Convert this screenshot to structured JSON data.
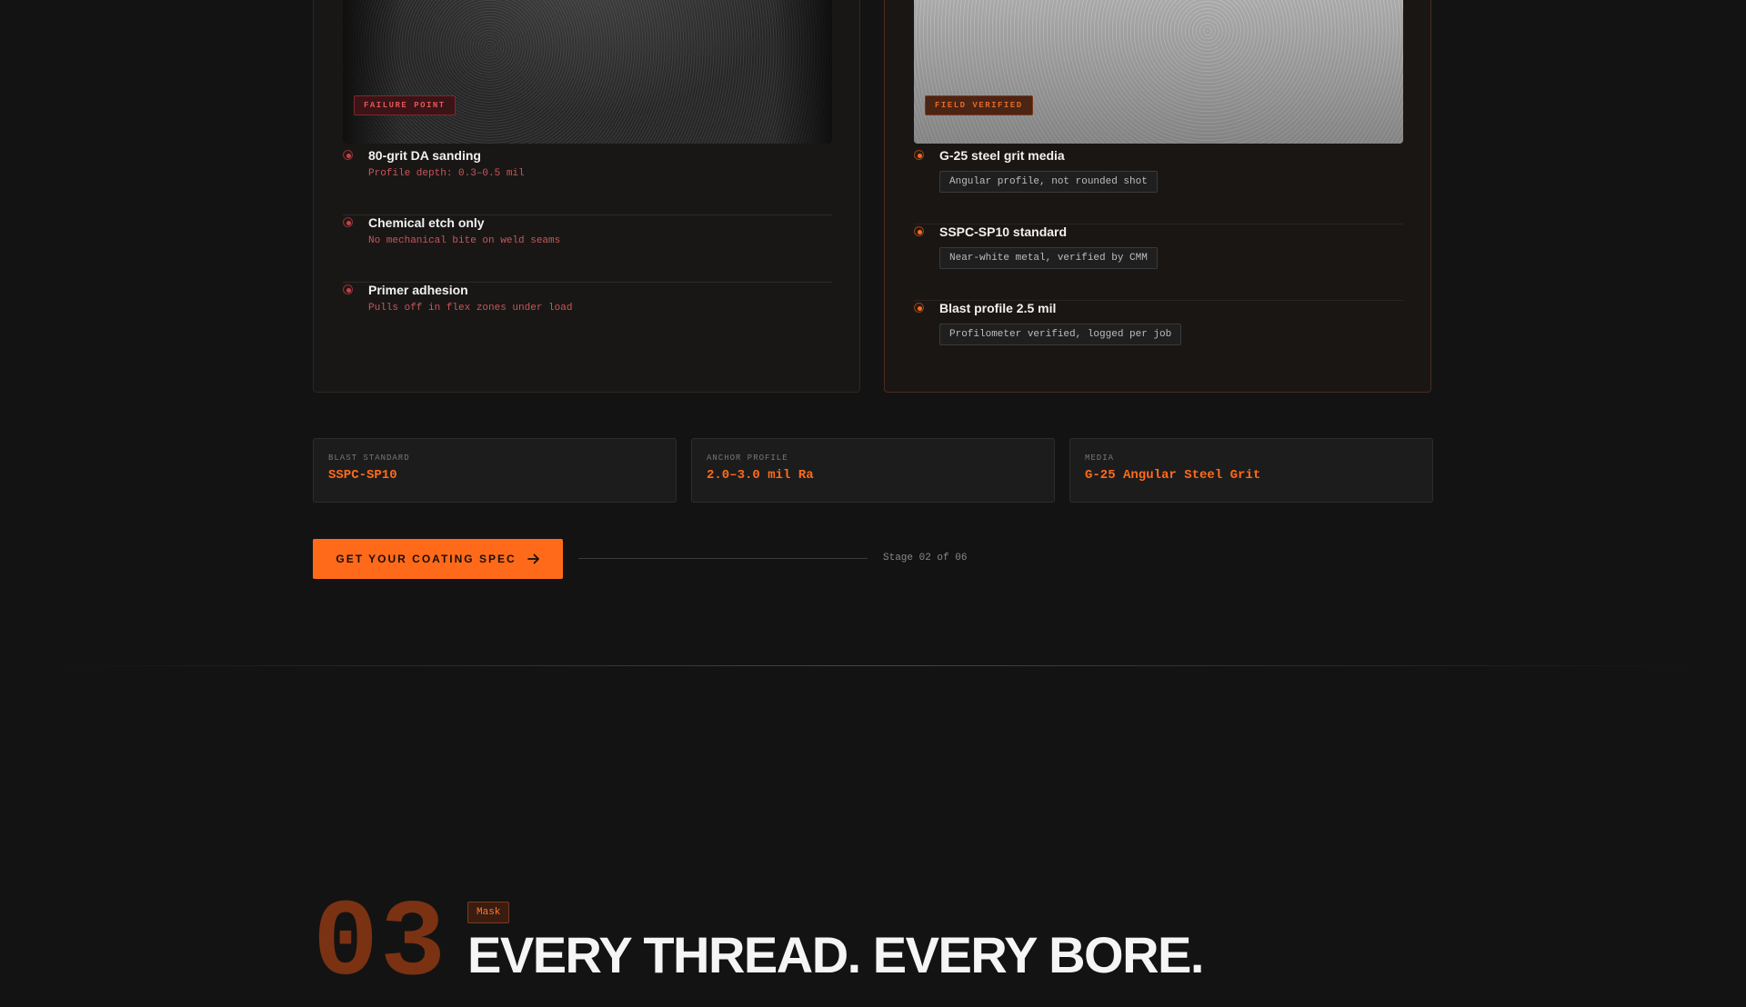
{
  "failure_card": {
    "tag": "FAILURE POINT",
    "items": [
      {
        "title": "80-grit DA sanding",
        "detail": "Profile depth: 0.3–0.5 mil"
      },
      {
        "title": "Chemical etch only",
        "detail": "No mechanical bite on weld seams"
      },
      {
        "title": "Primer adhesion",
        "detail": "Pulls off in flex zones under load"
      }
    ]
  },
  "verified_card": {
    "tag": "FIELD VERIFIED",
    "items": [
      {
        "title": "G-25 steel grit media",
        "detail": "Angular profile, not rounded shot"
      },
      {
        "title": "SSPC-SP10 standard",
        "detail": "Near-white metal, verified by CMM"
      },
      {
        "title": "Blast profile 2.5 mil",
        "detail": "Profilometer verified, logged per job"
      }
    ]
  },
  "stats": [
    {
      "label": "BLAST STANDARD",
      "value": "SSPC-SP10"
    },
    {
      "label": "ANCHOR PROFILE",
      "value": "2.0–3.0 mil Ra"
    },
    {
      "label": "MEDIA",
      "value": "G-25 Angular Steel Grit"
    }
  ],
  "cta": {
    "label": "GET YOUR COATING SPEC",
    "icon": "arrow-right-icon"
  },
  "stage_text": "Stage 02 of 06",
  "next_section": {
    "number": "03",
    "tag": "Mask",
    "title": "EVERY THREAD. EVERY BORE."
  },
  "colors": {
    "accent": "#ff6a1a",
    "failure": "#e0575a",
    "background": "#131313"
  }
}
